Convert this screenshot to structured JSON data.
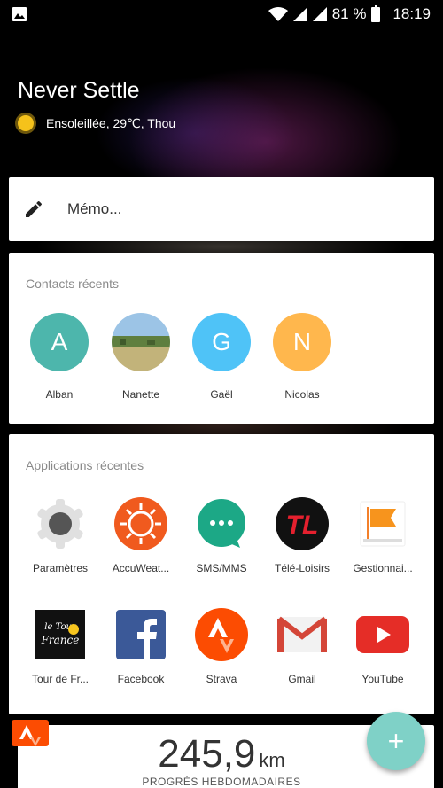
{
  "status_bar": {
    "battery": "81 %",
    "time": "18:19"
  },
  "header": {
    "title": "Never Settle",
    "weather": "Ensoleillée, 29℃, Thou"
  },
  "memo": {
    "label": "Mémo..."
  },
  "contacts": {
    "title": "Contacts récents",
    "items": [
      {
        "initial": "A",
        "name": "Alban",
        "color": "#4db6ac"
      },
      {
        "initial": "",
        "name": "Nanette",
        "color": "#6a8a5a"
      },
      {
        "initial": "G",
        "name": "Gaël",
        "color": "#4fc3f7"
      },
      {
        "initial": "N",
        "name": "Nicolas",
        "color": "#ffb74d"
      }
    ]
  },
  "apps": {
    "title": "Applications récentes",
    "items": [
      {
        "name": "Paramètres",
        "icon": "gear-icon"
      },
      {
        "name": "AccuWeat...",
        "icon": "sun-icon"
      },
      {
        "name": "SMS/MMS",
        "icon": "message-icon"
      },
      {
        "name": "Télé-Loisirs",
        "icon": "tl-icon"
      },
      {
        "name": "Gestionnai...",
        "icon": "flag-icon"
      },
      {
        "name": "Tour de Fr...",
        "icon": "tour-de-france-icon",
        "logo_text": "le Tour de France"
      },
      {
        "name": "Facebook",
        "icon": "facebook-icon"
      },
      {
        "name": "Strava",
        "icon": "strava-icon"
      },
      {
        "name": "Gmail",
        "icon": "gmail-icon"
      },
      {
        "name": "YouTube",
        "icon": "youtube-icon"
      }
    ]
  },
  "widget": {
    "value": "245,9",
    "unit": "km",
    "subtitle": "PROGRÈS HEBDOMADAIRES"
  },
  "fab": {
    "label": "+"
  },
  "colors": {
    "fab": "#7fd1c7",
    "strava": "#fc4c02"
  }
}
